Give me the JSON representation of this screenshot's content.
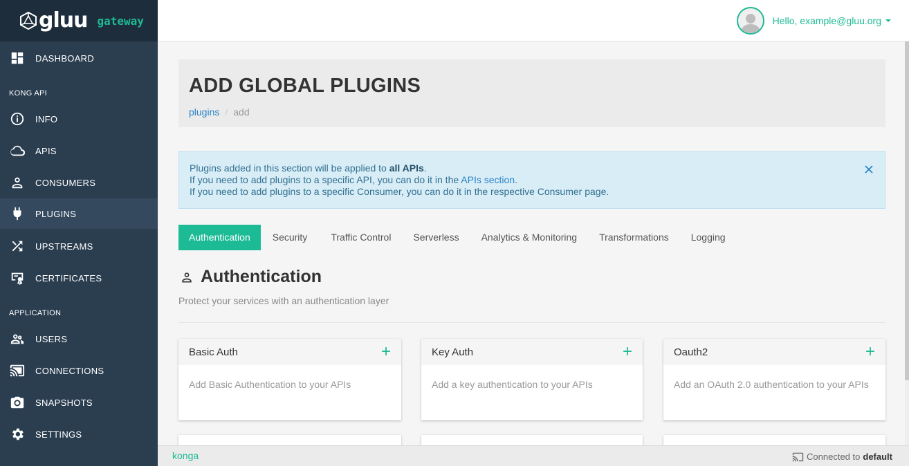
{
  "brand": {
    "name": "gluu",
    "sub": "gateway"
  },
  "sidebar": {
    "dashboard": "DASHBOARD",
    "section_kong": "KONG API",
    "info": "INFO",
    "apis": "APIS",
    "consumers": "CONSUMERS",
    "plugins": "PLUGINS",
    "upstreams": "UPSTREAMS",
    "certificates": "CERTIFICATES",
    "section_app": "APPLICATION",
    "users": "USERS",
    "connections": "CONNECTIONS",
    "snapshots": "SNAPSHOTS",
    "settings": "SETTINGS"
  },
  "topbar": {
    "greeting": "Hello, example@gluu.org"
  },
  "header": {
    "title": "ADD GLOBAL PLUGINS",
    "crumb_root": "plugins",
    "crumb_sep": "/",
    "crumb_current": "add"
  },
  "alert": {
    "line1_pre": "Plugins added in this section will be applied to ",
    "line1_bold": "all APIs",
    "line1_post": ".",
    "line2_pre": "If you need to add plugins to a specific API, you can do it in the ",
    "line2_link": "APIs section",
    "line2_post": ".",
    "line3": "If you need to add plugins to a specific Consumer, you can do it in the respective Consumer page."
  },
  "tabs": [
    "Authentication",
    "Security",
    "Traffic Control",
    "Serverless",
    "Analytics & Monitoring",
    "Transformations",
    "Logging"
  ],
  "section": {
    "title": "Authentication",
    "description": "Protect your services with an authentication layer"
  },
  "cards": [
    {
      "title": "Basic Auth",
      "description": "Add Basic Authentication to your APIs"
    },
    {
      "title": "Key Auth",
      "description": "Add a key authentication to your APIs"
    },
    {
      "title": "Oauth2",
      "description": "Add an OAuth 2.0 authentication to your APIs"
    }
  ],
  "add_symbol": "+",
  "footer": {
    "brand": "konga",
    "status_prefix": "Connected to",
    "status_target": "default"
  },
  "colors": {
    "accent": "#1dbb95",
    "sidebar": "#2b3e50",
    "link": "#2a84c6"
  }
}
